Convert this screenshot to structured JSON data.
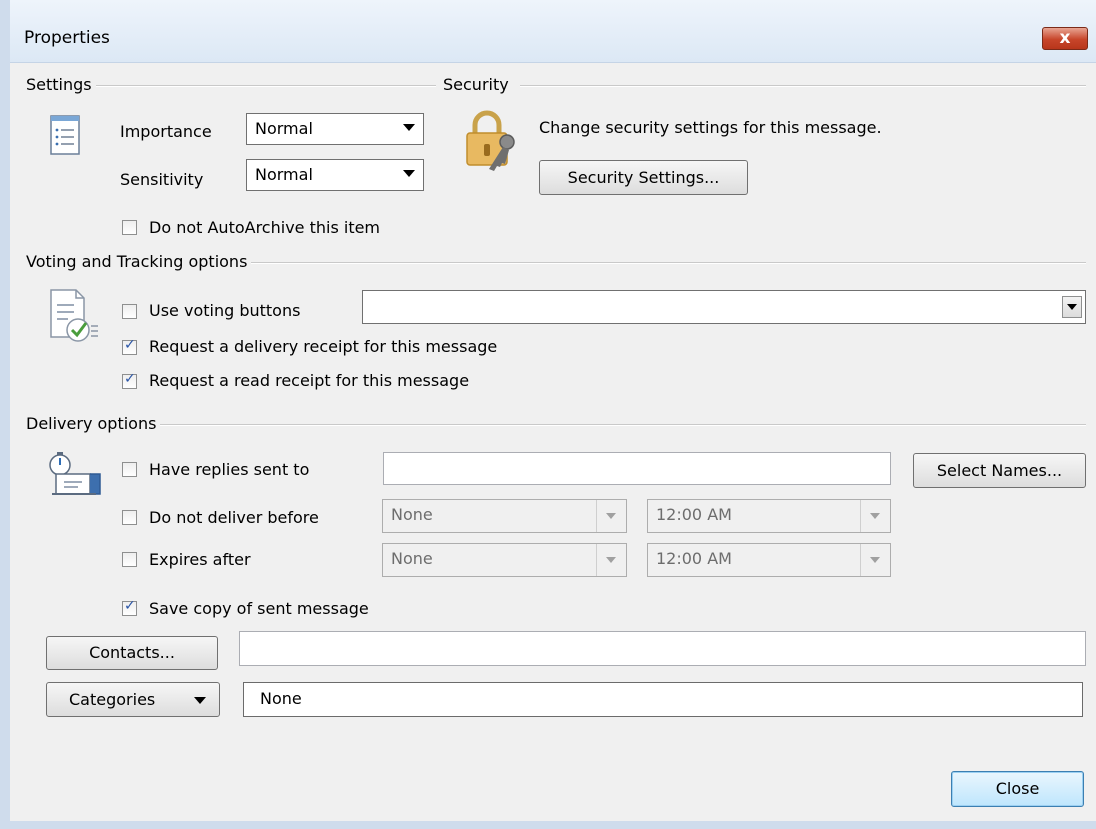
{
  "window": {
    "title": "Properties",
    "close_glyph": "x"
  },
  "settings": {
    "heading": "Settings",
    "importance_label": "Importance",
    "importance_value": "Normal",
    "sensitivity_label": "Sensitivity",
    "sensitivity_value": "Normal",
    "autoarchive_label": "Do not AutoArchive this item",
    "autoarchive_checked": false
  },
  "security": {
    "heading": "Security",
    "description": "Change security settings for this message.",
    "button_label": "Security Settings..."
  },
  "voting": {
    "heading": "Voting and Tracking options",
    "use_voting_label": "Use voting buttons",
    "use_voting_checked": false,
    "use_voting_value": "",
    "delivery_receipt_label": "Request a delivery receipt for this message",
    "delivery_receipt_checked": true,
    "read_receipt_label": "Request a read receipt for this message",
    "read_receipt_checked": true
  },
  "delivery": {
    "heading": "Delivery options",
    "replies_label": "Have replies sent to",
    "replies_value": "",
    "select_names_label": "Select Names...",
    "not_before_label": "Do not deliver before",
    "not_before_date": "None",
    "not_before_time": "12:00 AM",
    "expires_label": "Expires after",
    "expires_date": "None",
    "expires_time": "12:00 AM",
    "save_copy_label": "Save copy of sent message",
    "save_copy_checked": true
  },
  "contacts": {
    "button_label": "Contacts...",
    "value": ""
  },
  "categories": {
    "button_label": "Categories",
    "value": "None"
  },
  "footer": {
    "close_label": "Close"
  },
  "icons": [
    "settings-list-icon",
    "padlock-key-icon",
    "voting-check-icon",
    "delivery-timer-icon"
  ]
}
